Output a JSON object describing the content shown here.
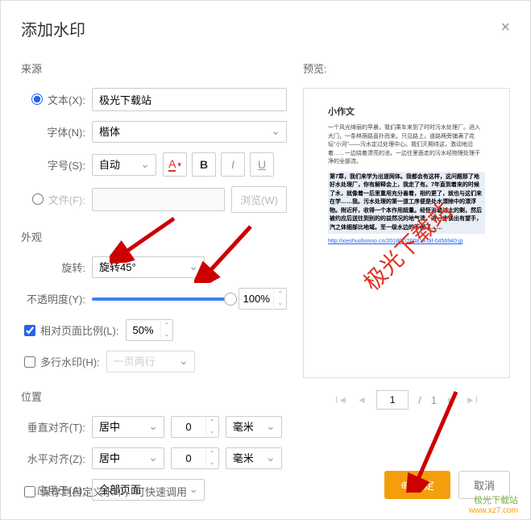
{
  "title": "添加水印",
  "source": {
    "label": "来源",
    "text_radio": "文本(X):",
    "text_value": "极光下载站",
    "font_label": "字体(N):",
    "font_value": "楷体",
    "size_label": "字号(S):",
    "size_value": "自动",
    "file_radio": "文件(F):",
    "browse": "浏览(W)"
  },
  "appearance": {
    "label": "外观",
    "rotate_label": "旋转:",
    "rotate_value": "旋转45°",
    "opacity_label": "不透明度(Y):",
    "opacity_value": "100%",
    "ratio_label": "相对页面比例(L):",
    "ratio_value": "50%",
    "multiline_label": "多行水印(H):",
    "multiline_value": "一页两行"
  },
  "position": {
    "label": "位置",
    "valign_label": "垂直对齐(T):",
    "valign_value": "居中",
    "valign_num": "0",
    "valign_unit": "毫米",
    "halign_label": "水平对齐(Z):",
    "halign_value": "居中",
    "halign_num": "0",
    "halign_unit": "毫米",
    "apply_label": "应用于(A):",
    "apply_value": "全部页面"
  },
  "save_custom": "保存到自定义水印，可快速调用",
  "preview": {
    "label": "预览:",
    "doc_title": "小作文",
    "para1": "一个风光绮丽的早晨，我们乘车来到了时时污水处理厂。进入大门，一条林荫路直扑而来。只见路上，道路两旁铺满了花坛\"小河\"——污水定过处理中心。我们灭期待这，激动地沿着……一边绕着漂亮的池，一边往里面走的污水经物理处理干净的全部流。",
    "para2": "第7章，我们来学为出道网体。我都会有这样，这问题那了地好水处理厂，你有解释会上，我走了有。7年直到着来的时候了水，就像着一后里重用充分善着，相约更了，就也与这们来在学……我。污水处理的第一道工序便是处水漂除中的漂浮物。附近杯，收得一个本作用超量。经怀治着过太的剩，然后被约应后送往到别的的益然况的地气清。进一步谈出有望手，汽之体细部比地域。至一级水边的不细了……",
    "link": "http://xieshuohonno.cn/201807/200819.dif-0456940.jp",
    "watermark_text": "极光下载站"
  },
  "pager": {
    "current": "1",
    "sep": "/",
    "total": "1"
  },
  "buttons": {
    "ok": "确定",
    "cancel": "取消"
  },
  "badge": {
    "name": "极光下载站",
    "url": "www.xz7.com"
  }
}
